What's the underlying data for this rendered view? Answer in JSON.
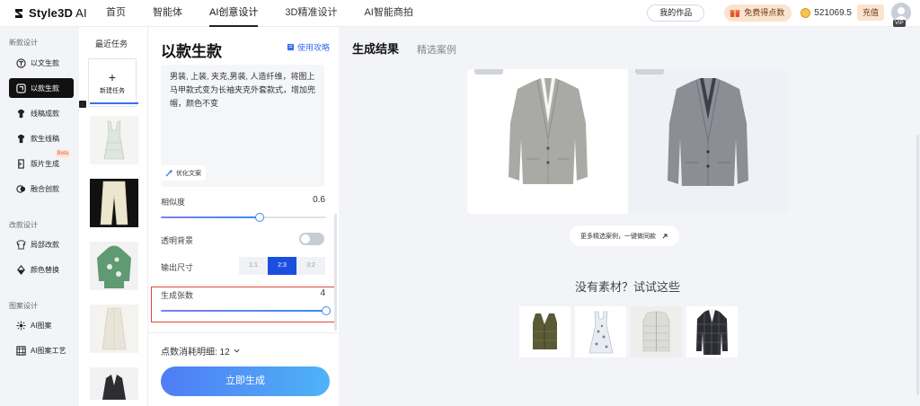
{
  "brand": {
    "name": "Style3D",
    "suffix": "AI"
  },
  "nav": [
    {
      "label": "首页",
      "active": false
    },
    {
      "label": "智能体",
      "active": false
    },
    {
      "label": "AI创意设计",
      "active": true
    },
    {
      "label": "3D精准设计",
      "active": false
    },
    {
      "label": "AI智能商拍",
      "active": false
    }
  ],
  "topright": {
    "works": "我的作品",
    "free_points": "免费得点数",
    "points": "521069.5",
    "recharge": "充值",
    "vip": "VIP"
  },
  "sidebar": {
    "group1": "新款设计",
    "group2": "改款设计",
    "group3": "图案设计",
    "items": [
      {
        "label": "以文生款",
        "icon": "text-to-style-icon"
      },
      {
        "label": "以款生款",
        "icon": "style-to-style-icon"
      },
      {
        "label": "线稿成款",
        "icon": "sketch-to-style-icon"
      },
      {
        "label": "款生线稿",
        "icon": "style-to-sketch-icon"
      },
      {
        "label": "版片生成",
        "icon": "pattern-piece-icon",
        "badge": "Beta"
      },
      {
        "label": "融合创款",
        "icon": "fusion-icon"
      },
      {
        "label": "局部改款",
        "icon": "local-edit-icon"
      },
      {
        "label": "颜色替换",
        "icon": "color-replace-icon"
      },
      {
        "label": "AI图案",
        "icon": "ai-pattern-icon"
      },
      {
        "label": "AI图案工艺",
        "icon": "ai-pattern-craft-icon"
      }
    ]
  },
  "recent": {
    "title": "最近任务",
    "new_task": "新建任务",
    "plus": "+"
  },
  "form": {
    "title": "以款生款",
    "guide": "使用攻略",
    "prompt": "男装, 上装, 夹克,男装, 人造纤维，将图上马甲款式变为长袖夹克外套款式，增加兜帽，颜色不变",
    "optimize": "优化文案",
    "similarity_label": "相似度",
    "similarity_value": "0.6",
    "similarity_level": 0.6,
    "transparent_label": "透明背景",
    "transparent_on": false,
    "size_label": "输出尺寸",
    "sizes": [
      "1:1",
      "2:3",
      "3:2"
    ],
    "size_selected": "2:3",
    "count_label": "生成张数",
    "count_value": "4",
    "count_level": 1.0,
    "cost_label": "点数消耗明细: 12",
    "generate": "立即生成"
  },
  "main": {
    "tab_active": "生成结果",
    "tab_other": "精选案例",
    "more_cases": "更多精选案例，一键做同款",
    "no_material": "没有素材？试试这些"
  },
  "colors": {
    "accent": "#1b4fe0",
    "highlight": "#e0493e",
    "button_start": "#4f7cf5",
    "button_end": "#4fb3f7"
  }
}
